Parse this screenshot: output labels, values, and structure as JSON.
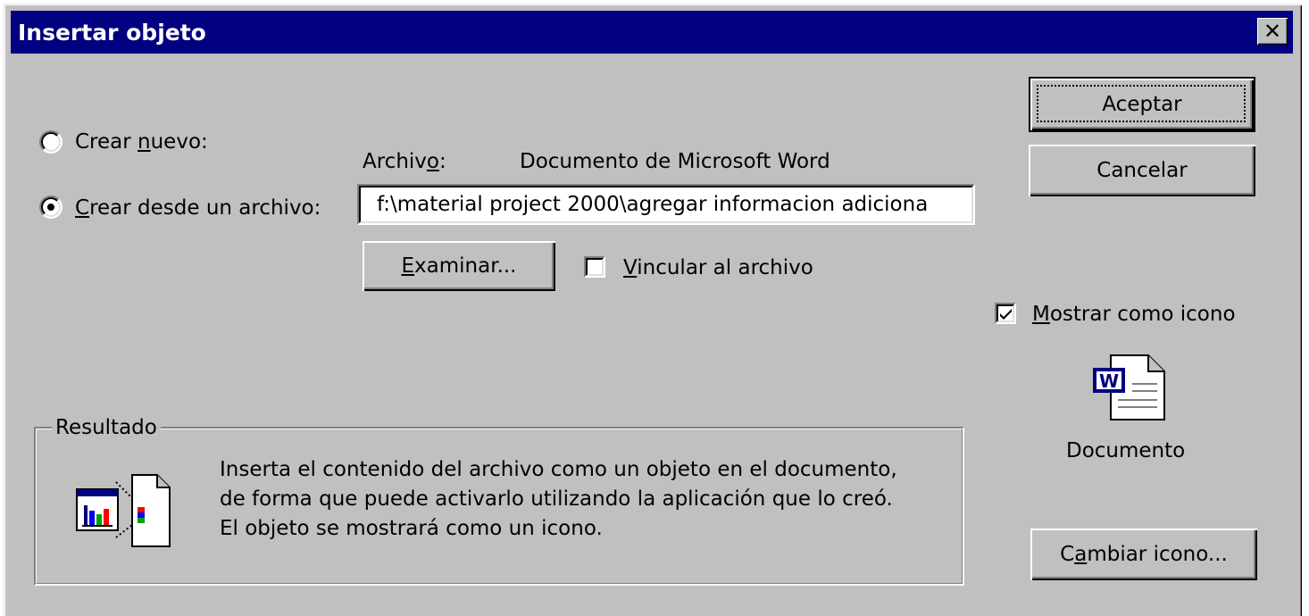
{
  "dialog": {
    "title": "Insertar objeto",
    "close_glyph": "✕"
  },
  "options": {
    "create_new": {
      "prefix": "Crear ",
      "mnemonic": "n",
      "suffix": "uevo:",
      "selected": false
    },
    "create_from_file": {
      "prefix": "",
      "mnemonic": "C",
      "suffix": "rear desde un archivo:",
      "selected": true
    }
  },
  "file": {
    "label_prefix": "Archiv",
    "label_mnemonic": "o",
    "label_suffix": ":",
    "type_text": "Documento de Microsoft Word",
    "path_value": "f:\\material project 2000\\agregar informacion adiciona"
  },
  "browse_button": {
    "mnemonic": "E",
    "suffix": "xaminar..."
  },
  "link_checkbox": {
    "mnemonic": "V",
    "suffix": "incular al archivo",
    "checked": false
  },
  "buttons": {
    "ok": "Aceptar",
    "cancel": "Cancelar"
  },
  "display_as_icon": {
    "mnemonic": "M",
    "suffix": "ostrar como icono",
    "checked": true
  },
  "icon_caption": "Documento",
  "change_icon_button": {
    "prefix": "C",
    "mnemonic": "a",
    "suffix": "mbiar icono..."
  },
  "result": {
    "legend": "Resultado",
    "lines": [
      "Inserta el contenido del archivo como un objeto en el documento,",
      "de forma que puede activarlo utilizando la aplicación que lo creó.",
      "El objeto se mostrará como un icono."
    ]
  },
  "icons": {
    "word_document": "word-document-icon",
    "result_preview": "embedded-object-icon"
  }
}
